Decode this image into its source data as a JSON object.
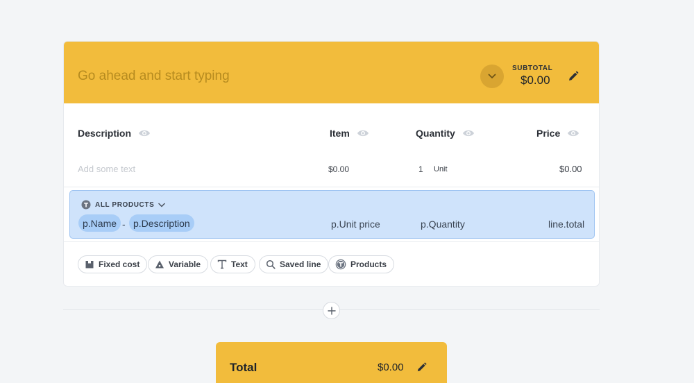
{
  "header": {
    "placeholder": "Go ahead and start typing",
    "subtotal_label": "SUBTOTAL",
    "subtotal_value": "$0.00"
  },
  "columns": {
    "description": "Description",
    "item": "Item",
    "quantity": "Quantity",
    "price": "Price"
  },
  "line": {
    "description_placeholder": "Add some text",
    "item": "$0.00",
    "quantity": "1",
    "unit": "Unit",
    "price": "$0.00"
  },
  "products_row": {
    "label": "ALL PRODUCTS",
    "name_chip": "p.Name",
    "separator": "-",
    "description_chip": "p.Description",
    "unit_price": "p.Unit price",
    "quantity": "p.Quantity",
    "total": "line.total"
  },
  "add_buttons": [
    {
      "label": "Fixed cost",
      "icon": "fixed-cost-icon"
    },
    {
      "label": "Variable",
      "icon": "variable-icon"
    },
    {
      "label": "Text",
      "icon": "text-icon"
    },
    {
      "label": "Saved line",
      "icon": "search-icon"
    },
    {
      "label": "Products",
      "icon": "products-icon"
    }
  ],
  "total": {
    "label": "Total",
    "value": "$0.00"
  },
  "colors": {
    "accent": "#f2bc3c",
    "selection": "#cfe3fb",
    "chip": "#a8cdf7"
  }
}
